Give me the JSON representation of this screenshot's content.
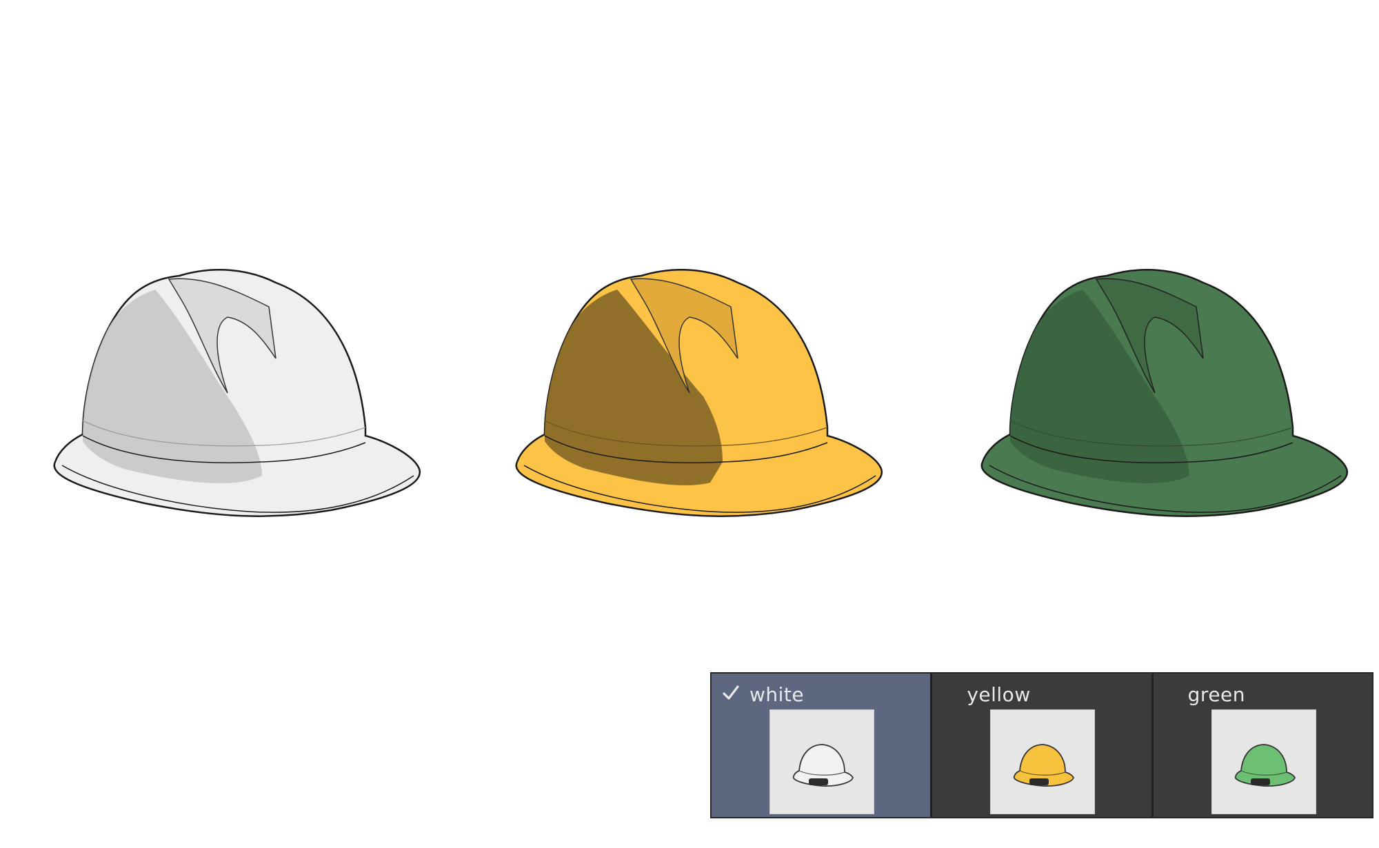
{
  "helmets": [
    {
      "id": "white",
      "shell": "#efefef",
      "shade": "#c4c4c4",
      "outline": "#1a1a1a"
    },
    {
      "id": "yellow",
      "shell": "#fdc347",
      "shade": "#8a6a28",
      "outline": "#1a1a1a"
    },
    {
      "id": "green",
      "shell": "#4a7a4f",
      "shade": "#3a623e",
      "outline": "#1a1a1a"
    }
  ],
  "variants": {
    "selected": "white",
    "items": [
      {
        "label": "white",
        "thumb_color": "#f2f2f2",
        "selected": true
      },
      {
        "label": "yellow",
        "thumb_color": "#f7c23e",
        "selected": false
      },
      {
        "label": "green",
        "thumb_color": "#6dbf73",
        "selected": false
      }
    ],
    "check_icon": "check-icon",
    "panel_bg": "#3b3b3b",
    "selected_bg": "#5e6780"
  }
}
